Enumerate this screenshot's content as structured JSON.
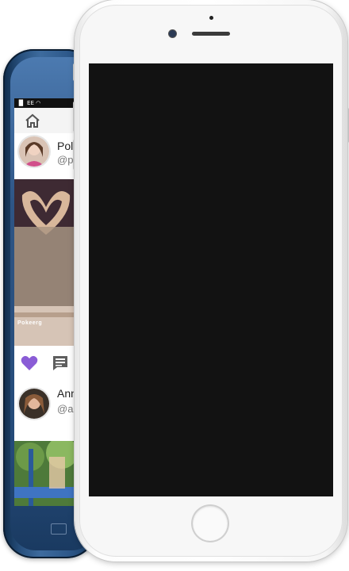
{
  "status_bar": {
    "carrier": "EE"
  },
  "feed": {
    "posts": [
      {
        "name": "Pol",
        "handle": "@p",
        "watermark": "Pokeerg"
      },
      {
        "name": "Ann",
        "handle": "@a"
      }
    ],
    "liked_color": "#8a5cd6"
  },
  "colors": {
    "back_phone_body": "#2d588a",
    "front_phone_body": "#ffffff",
    "front_screen": "#121212"
  },
  "icons": {
    "home": "home-icon",
    "like": "heart-icon",
    "comment": "comment-icon"
  }
}
